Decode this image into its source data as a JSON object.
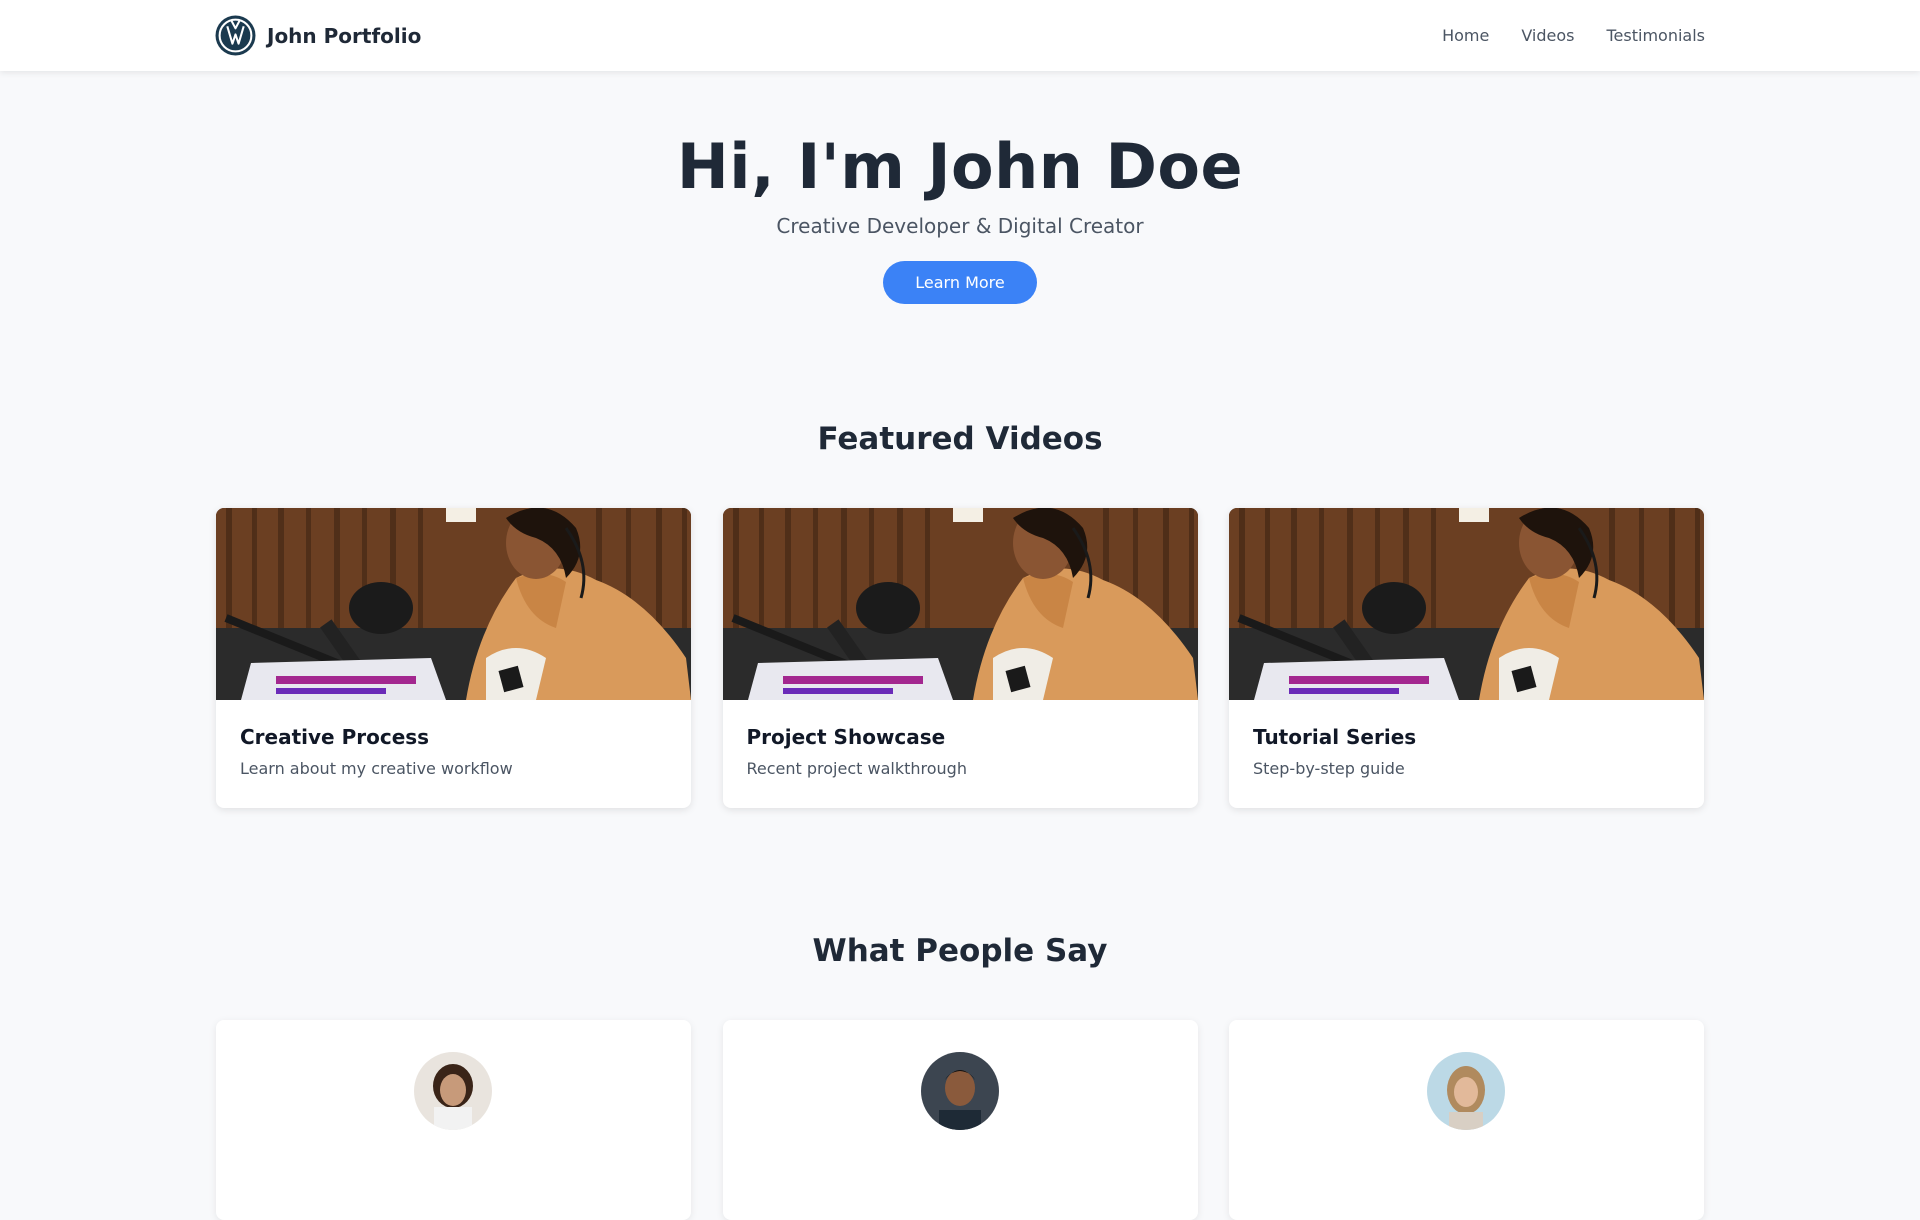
{
  "nav": {
    "brand_icon": "vw-logo-icon",
    "brand_name": "John Portfolio",
    "links": [
      {
        "label": "Home"
      },
      {
        "label": "Videos"
      },
      {
        "label": "Testimonials"
      }
    ]
  },
  "hero": {
    "title": "Hi, I'm John Doe",
    "subtitle": "Creative Developer & Digital Creator",
    "button_label": "Learn More"
  },
  "videos": {
    "heading": "Featured Videos",
    "items": [
      {
        "title": "Creative Process",
        "description": "Learn about my creative workflow"
      },
      {
        "title": "Project Showcase",
        "description": "Recent project walkthrough"
      },
      {
        "title": "Tutorial Series",
        "description": "Step-by-step guide"
      }
    ]
  },
  "testimonials": {
    "heading": "What People Say"
  },
  "colors": {
    "accent": "#3b82f6",
    "page_background": "#f8f9fb",
    "text_dark": "#1f2937",
    "text_muted": "#4b5563"
  }
}
